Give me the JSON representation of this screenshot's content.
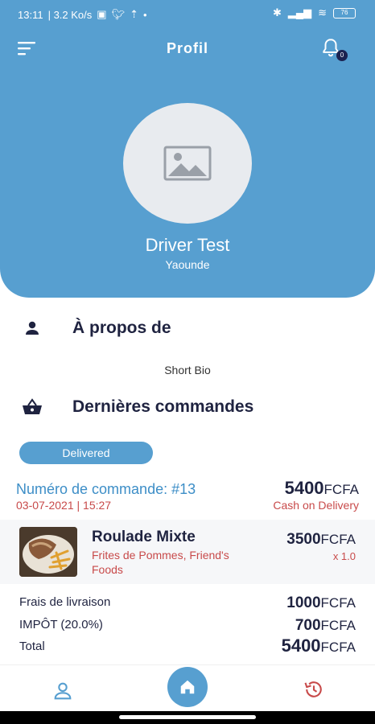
{
  "status_bar": {
    "time": "13:11",
    "speed": "| 3.2 Ko/s",
    "battery": "76"
  },
  "header": {
    "title": "Profil",
    "notification_count": "0"
  },
  "profile": {
    "name": "Driver Test",
    "city": "Yaounde"
  },
  "about": {
    "title": "À propos de",
    "bio": "Short Bio"
  },
  "orders": {
    "title": "Dernières commandes",
    "status_filter": "Delivered",
    "order": {
      "number": "Numéro de commande: #13",
      "date": "03-07-2021 | 15:27",
      "total_amount": "5400",
      "currency": "FCFA",
      "payment_method": "Cash on Delivery",
      "item": {
        "name": "Roulade Mixte",
        "description": "Frites de Pommes, Friend's Foods",
        "price": "3500",
        "quantity": "x 1.0"
      },
      "fees": [
        {
          "label": "Frais de livraison",
          "amount": "1000"
        },
        {
          "label": "IMPÔT (20.0%)",
          "amount": "700"
        },
        {
          "label": "Total",
          "amount": "5400"
        }
      ]
    }
  },
  "colors": {
    "primary": "#579fd0",
    "accent_red": "#c84a4a",
    "dark_text": "#1f2340"
  },
  "icons": {
    "menu": "menu-icon",
    "bell": "bell-icon",
    "profile_placeholder": "image-placeholder-icon",
    "about": "person-icon",
    "orders": "basket-icon",
    "nav_profile": "user-outline-icon",
    "nav_home": "home-icon",
    "nav_history": "history-icon"
  }
}
